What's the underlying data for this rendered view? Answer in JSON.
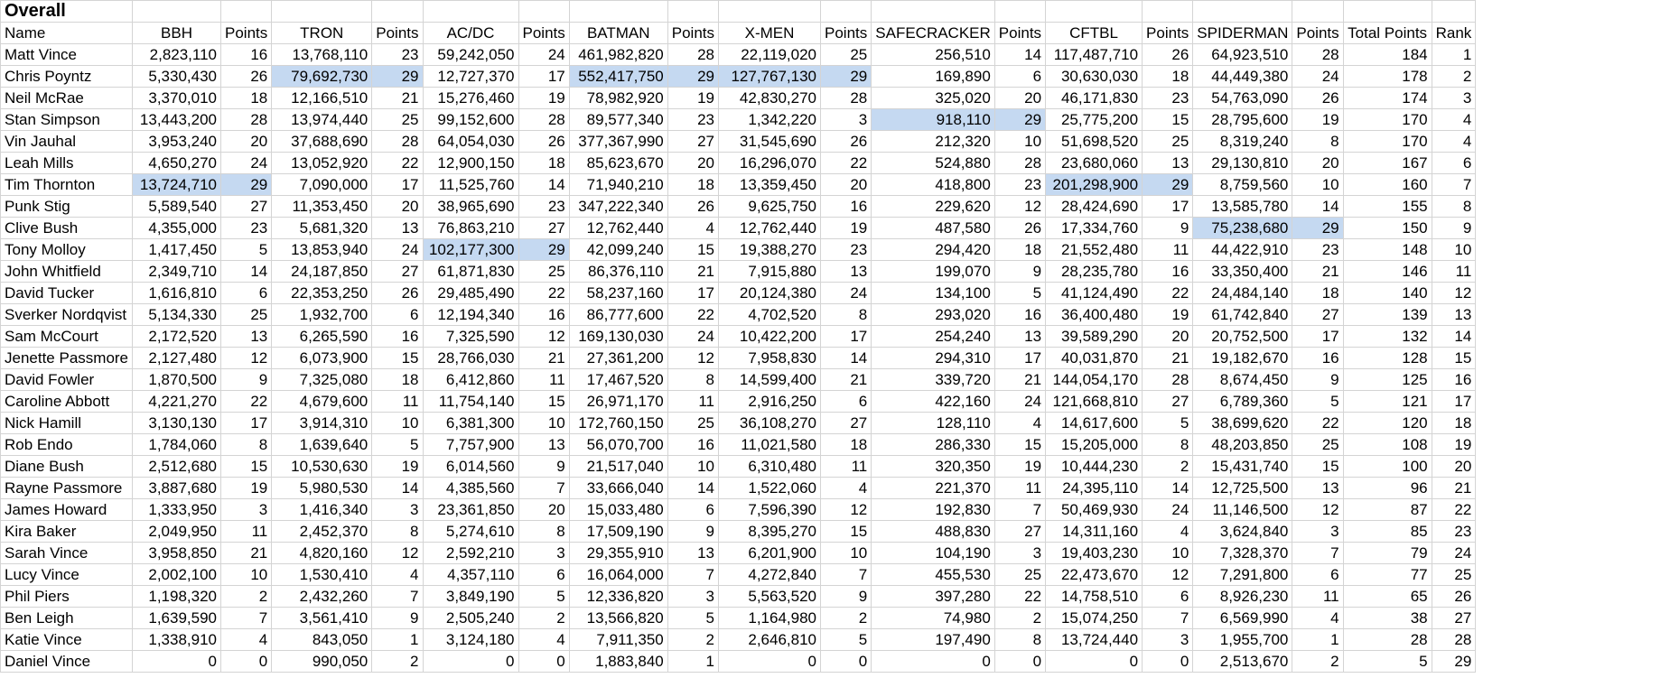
{
  "title": "Overall",
  "columns": [
    "Name",
    "BBH",
    "Points",
    "TRON",
    "Points",
    "AC/DC",
    "Points",
    "BATMAN",
    "Points",
    "X-MEN",
    "Points",
    "SAFECRACKER",
    "Points",
    "CFTBL",
    "Points",
    "SPIDERMAN",
    "Points",
    "Total Points",
    "Rank"
  ],
  "highlight_color": "#c5d9f1",
  "rows": [
    [
      "Matt Vince",
      "2,823,110",
      "16",
      "13,768,110",
      "23",
      "59,242,050",
      "24",
      "461,982,820",
      "28",
      "22,119,020",
      "25",
      "256,510",
      "14",
      "117,487,710",
      "26",
      "64,923,510",
      "28",
      "184",
      "1"
    ],
    [
      "Chris Poyntz",
      "5,330,430",
      "26",
      "79,692,730",
      "29",
      "12,727,370",
      "17",
      "552,417,750",
      "29",
      "127,767,130",
      "29",
      "169,890",
      "6",
      "30,630,030",
      "18",
      "44,449,380",
      "24",
      "178",
      "2"
    ],
    [
      "Neil McRae",
      "3,370,010",
      "18",
      "12,166,510",
      "21",
      "15,276,460",
      "19",
      "78,982,920",
      "19",
      "42,830,270",
      "28",
      "325,020",
      "20",
      "46,171,830",
      "23",
      "54,763,090",
      "26",
      "174",
      "3"
    ],
    [
      "Stan Simpson",
      "13,443,200",
      "28",
      "13,974,440",
      "25",
      "99,152,600",
      "28",
      "89,577,340",
      "23",
      "1,342,220",
      "3",
      "918,110",
      "29",
      "25,775,200",
      "15",
      "28,795,600",
      "19",
      "170",
      "4"
    ],
    [
      "Vin Jauhal",
      "3,953,240",
      "20",
      "37,688,690",
      "28",
      "64,054,030",
      "26",
      "377,367,990",
      "27",
      "31,545,690",
      "26",
      "212,320",
      "10",
      "51,698,520",
      "25",
      "8,319,240",
      "8",
      "170",
      "4"
    ],
    [
      "Leah Mills",
      "4,650,270",
      "24",
      "13,052,920",
      "22",
      "12,900,150",
      "18",
      "85,623,670",
      "20",
      "16,296,070",
      "22",
      "524,880",
      "28",
      "23,680,060",
      "13",
      "29,130,810",
      "20",
      "167",
      "6"
    ],
    [
      "Tim Thornton",
      "13,724,710",
      "29",
      "7,090,000",
      "17",
      "11,525,760",
      "14",
      "71,940,210",
      "18",
      "13,359,450",
      "20",
      "418,800",
      "23",
      "201,298,900",
      "29",
      "8,759,560",
      "10",
      "160",
      "7"
    ],
    [
      "Punk Stig",
      "5,589,540",
      "27",
      "11,353,450",
      "20",
      "38,965,690",
      "23",
      "347,222,340",
      "26",
      "9,625,750",
      "16",
      "229,620",
      "12",
      "28,424,690",
      "17",
      "13,585,780",
      "14",
      "155",
      "8"
    ],
    [
      "Clive Bush",
      "4,355,000",
      "23",
      "5,681,320",
      "13",
      "76,863,210",
      "27",
      "12,762,440",
      "4",
      "12,762,440",
      "19",
      "487,580",
      "26",
      "17,334,760",
      "9",
      "75,238,680",
      "29",
      "150",
      "9"
    ],
    [
      "Tony Molloy",
      "1,417,450",
      "5",
      "13,853,940",
      "24",
      "102,177,300",
      "29",
      "42,099,240",
      "15",
      "19,388,270",
      "23",
      "294,420",
      "18",
      "21,552,480",
      "11",
      "44,422,910",
      "23",
      "148",
      "10"
    ],
    [
      "John Whitfield",
      "2,349,710",
      "14",
      "24,187,850",
      "27",
      "61,871,830",
      "25",
      "86,376,110",
      "21",
      "7,915,880",
      "13",
      "199,070",
      "9",
      "28,235,780",
      "16",
      "33,350,400",
      "21",
      "146",
      "11"
    ],
    [
      "David Tucker",
      "1,616,810",
      "6",
      "22,353,250",
      "26",
      "29,485,490",
      "22",
      "58,237,160",
      "17",
      "20,124,380",
      "24",
      "134,100",
      "5",
      "41,124,490",
      "22",
      "24,484,140",
      "18",
      "140",
      "12"
    ],
    [
      "Sverker Nordqvist",
      "5,134,330",
      "25",
      "1,932,700",
      "6",
      "12,194,340",
      "16",
      "86,777,600",
      "22",
      "4,702,520",
      "8",
      "293,020",
      "16",
      "36,400,480",
      "19",
      "61,742,840",
      "27",
      "139",
      "13"
    ],
    [
      "Sam McCourt",
      "2,172,520",
      "13",
      "6,265,590",
      "16",
      "7,325,590",
      "12",
      "169,130,030",
      "24",
      "10,422,200",
      "17",
      "254,240",
      "13",
      "39,589,290",
      "20",
      "20,752,500",
      "17",
      "132",
      "14"
    ],
    [
      "Jenette Passmore",
      "2,127,480",
      "12",
      "6,073,900",
      "15",
      "28,766,030",
      "21",
      "27,361,200",
      "12",
      "7,958,830",
      "14",
      "294,310",
      "17",
      "40,031,870",
      "21",
      "19,182,670",
      "16",
      "128",
      "15"
    ],
    [
      "David Fowler",
      "1,870,500",
      "9",
      "7,325,080",
      "18",
      "6,412,860",
      "11",
      "17,467,520",
      "8",
      "14,599,400",
      "21",
      "339,720",
      "21",
      "144,054,170",
      "28",
      "8,674,450",
      "9",
      "125",
      "16"
    ],
    [
      "Caroline Abbott",
      "4,221,270",
      "22",
      "4,679,600",
      "11",
      "11,754,140",
      "15",
      "26,971,170",
      "11",
      "2,916,250",
      "6",
      "422,160",
      "24",
      "121,668,810",
      "27",
      "6,789,360",
      "5",
      "121",
      "17"
    ],
    [
      "Nick Hamill",
      "3,130,130",
      "17",
      "3,914,310",
      "10",
      "6,381,300",
      "10",
      "172,760,150",
      "25",
      "36,108,270",
      "27",
      "128,110",
      "4",
      "14,617,600",
      "5",
      "38,699,620",
      "22",
      "120",
      "18"
    ],
    [
      "Rob Endo",
      "1,784,060",
      "8",
      "1,639,640",
      "5",
      "7,757,900",
      "13",
      "56,070,700",
      "16",
      "11,021,580",
      "18",
      "286,330",
      "15",
      "15,205,000",
      "8",
      "48,203,850",
      "25",
      "108",
      "19"
    ],
    [
      "Diane Bush",
      "2,512,680",
      "15",
      "10,530,630",
      "19",
      "6,014,560",
      "9",
      "21,517,040",
      "10",
      "6,310,480",
      "11",
      "320,350",
      "19",
      "10,444,230",
      "2",
      "15,431,740",
      "15",
      "100",
      "20"
    ],
    [
      "Rayne Passmore",
      "3,887,680",
      "19",
      "5,980,530",
      "14",
      "4,385,560",
      "7",
      "33,666,040",
      "14",
      "1,522,060",
      "4",
      "221,370",
      "11",
      "24,395,110",
      "14",
      "12,725,500",
      "13",
      "96",
      "21"
    ],
    [
      "James Howard",
      "1,333,950",
      "3",
      "1,416,340",
      "3",
      "23,361,850",
      "20",
      "15,033,480",
      "6",
      "7,596,390",
      "12",
      "192,830",
      "7",
      "50,469,930",
      "24",
      "11,146,500",
      "12",
      "87",
      "22"
    ],
    [
      "Kira Baker",
      "2,049,950",
      "11",
      "2,452,370",
      "8",
      "5,274,610",
      "8",
      "17,509,190",
      "9",
      "8,395,270",
      "15",
      "488,830",
      "27",
      "14,311,160",
      "4",
      "3,624,840",
      "3",
      "85",
      "23"
    ],
    [
      "Sarah Vince",
      "3,958,850",
      "21",
      "4,820,160",
      "12",
      "2,592,210",
      "3",
      "29,355,910",
      "13",
      "6,201,900",
      "10",
      "104,190",
      "3",
      "19,403,230",
      "10",
      "7,328,370",
      "7",
      "79",
      "24"
    ],
    [
      "Lucy Vince",
      "2,002,100",
      "10",
      "1,530,410",
      "4",
      "4,357,110",
      "6",
      "16,064,000",
      "7",
      "4,272,840",
      "7",
      "455,530",
      "25",
      "22,473,670",
      "12",
      "7,291,800",
      "6",
      "77",
      "25"
    ],
    [
      "Phil Piers",
      "1,198,320",
      "2",
      "2,432,260",
      "7",
      "3,849,190",
      "5",
      "12,336,820",
      "3",
      "5,563,520",
      "9",
      "397,280",
      "22",
      "14,758,510",
      "6",
      "8,926,230",
      "11",
      "65",
      "26"
    ],
    [
      "Ben Leigh",
      "1,639,590",
      "7",
      "3,561,410",
      "9",
      "2,505,240",
      "2",
      "13,566,820",
      "5",
      "1,164,980",
      "2",
      "74,980",
      "2",
      "15,074,250",
      "7",
      "6,569,990",
      "4",
      "38",
      "27"
    ],
    [
      "Katie Vince",
      "1,338,910",
      "4",
      "843,050",
      "1",
      "3,124,180",
      "4",
      "7,911,350",
      "2",
      "2,646,810",
      "5",
      "197,490",
      "8",
      "13,724,440",
      "3",
      "1,955,700",
      "1",
      "28",
      "28"
    ],
    [
      "Daniel Vince",
      "0",
      "0",
      "990,050",
      "2",
      "0",
      "0",
      "1,883,840",
      "1",
      "0",
      "0",
      "0",
      "0",
      "0",
      "0",
      "2,513,670",
      "2",
      "5",
      "29"
    ]
  ]
}
